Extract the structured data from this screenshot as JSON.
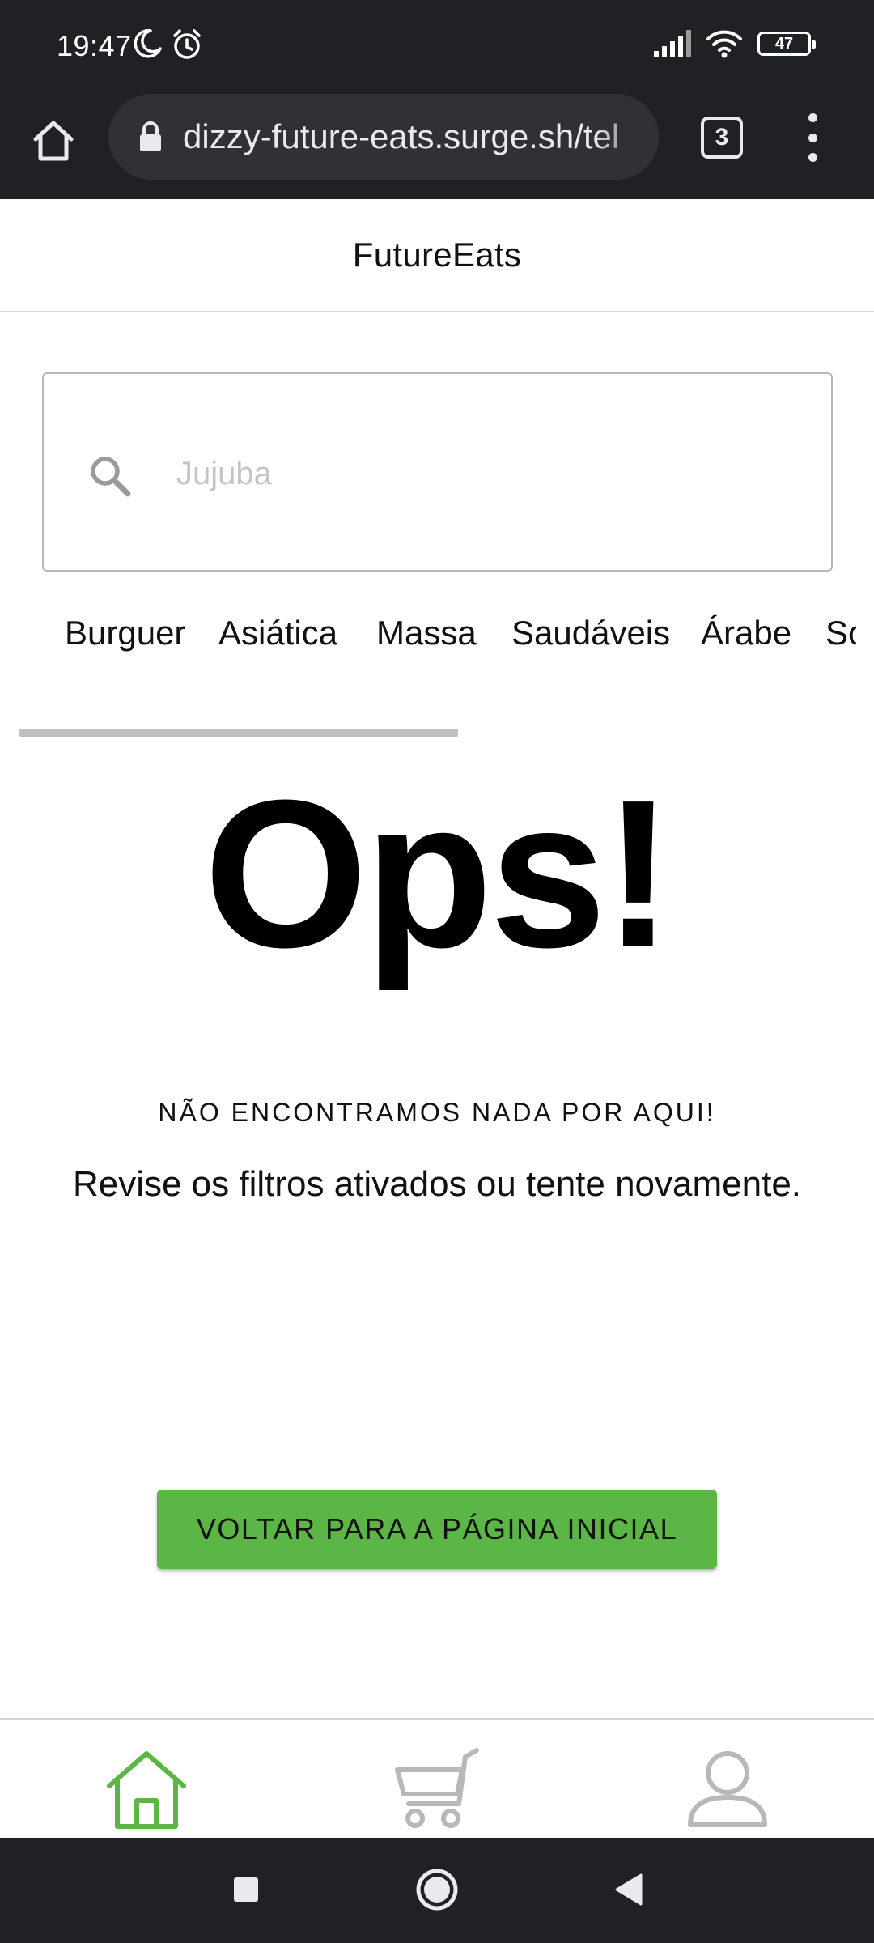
{
  "status_bar": {
    "time": "19:47",
    "battery": "47",
    "icons": [
      "moon-icon",
      "alarm-icon",
      "signal-icon",
      "wifi-icon",
      "battery-icon"
    ]
  },
  "browser": {
    "url": "dizzy-future-eats.surge.sh/tel",
    "tab_count": "3"
  },
  "app": {
    "title": "FutureEats"
  },
  "search": {
    "placeholder": "Jujuba",
    "value": ""
  },
  "categories": [
    "Burguer",
    "Asiática",
    "Massa",
    "Saudáveis",
    "Árabe",
    "Sorvetes"
  ],
  "empty_state": {
    "headline": "Ops!",
    "subtitle": "NÃO ENCONTRAMOS NADA POR AQUI!",
    "message": "Revise os filtros ativados ou tente novamente.",
    "button_label": "VOLTAR PARA A PÁGINA INICIAL"
  },
  "bottom_nav": {
    "items": [
      {
        "name": "home",
        "icon": "home-icon",
        "active": true
      },
      {
        "name": "cart",
        "icon": "cart-icon",
        "active": false
      },
      {
        "name": "profile",
        "icon": "profile-icon",
        "active": false
      }
    ]
  },
  "colors": {
    "accent": "#5cb646",
    "inactive_icon": "#b8b8b8",
    "system_bar": "#202124"
  }
}
